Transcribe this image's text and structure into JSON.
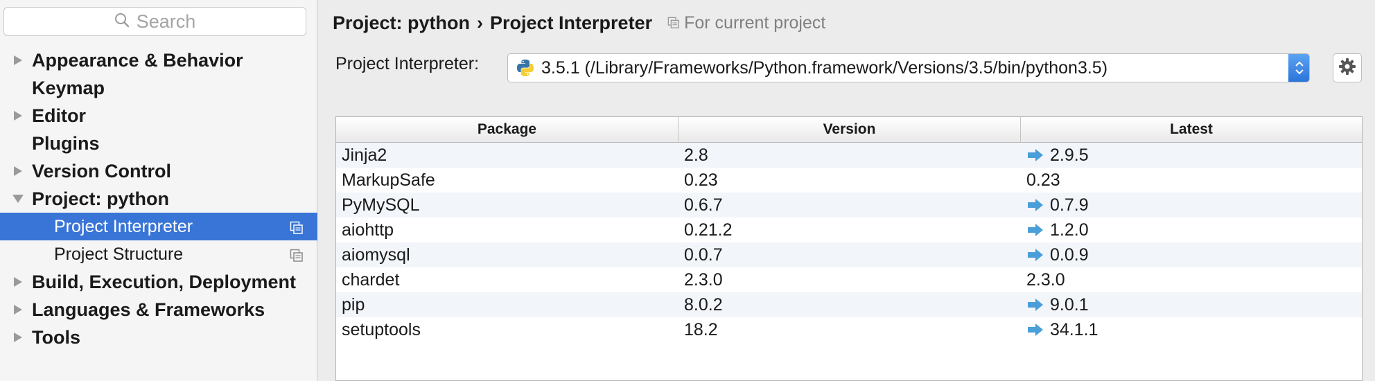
{
  "search": {
    "placeholder": "Search"
  },
  "sidebar": {
    "items": [
      {
        "label": "Appearance & Behavior",
        "expandable": true,
        "expanded": false
      },
      {
        "label": "Keymap",
        "expandable": false
      },
      {
        "label": "Editor",
        "expandable": true,
        "expanded": false
      },
      {
        "label": "Plugins",
        "expandable": false
      },
      {
        "label": "Version Control",
        "expandable": true,
        "expanded": false
      },
      {
        "label": "Project: python",
        "expandable": true,
        "expanded": true
      },
      {
        "label": "Project Interpreter",
        "sub": true,
        "selected": true
      },
      {
        "label": "Project Structure",
        "sub": true
      },
      {
        "label": "Build, Execution, Deployment",
        "expandable": true,
        "expanded": false
      },
      {
        "label": "Languages & Frameworks",
        "expandable": true,
        "expanded": false
      },
      {
        "label": "Tools",
        "expandable": true,
        "expanded": false
      }
    ]
  },
  "breadcrumb": {
    "parent": "Project: python",
    "separator": "›",
    "current": "Project Interpreter",
    "scope": "For current project"
  },
  "interpreter": {
    "label": "Project Interpreter:",
    "value": "3.5.1 (/Library/Frameworks/Python.framework/Versions/3.5/bin/python3.5)"
  },
  "packages": {
    "headers": [
      "Package",
      "Version",
      "Latest"
    ],
    "rows": [
      {
        "package": "Jinja2",
        "version": "2.8",
        "latest": "2.9.5",
        "upgrade": true
      },
      {
        "package": "MarkupSafe",
        "version": "0.23",
        "latest": "0.23",
        "upgrade": false
      },
      {
        "package": "PyMySQL",
        "version": "0.6.7",
        "latest": "0.7.9",
        "upgrade": true
      },
      {
        "package": "aiohttp",
        "version": "0.21.2",
        "latest": "1.2.0",
        "upgrade": true
      },
      {
        "package": "aiomysql",
        "version": "0.0.7",
        "latest": "0.0.9",
        "upgrade": true
      },
      {
        "package": "chardet",
        "version": "2.3.0",
        "latest": "2.3.0",
        "upgrade": false
      },
      {
        "package": "pip",
        "version": "8.0.2",
        "latest": "9.0.1",
        "upgrade": true
      },
      {
        "package": "setuptools",
        "version": "18.2",
        "latest": "34.1.1",
        "upgrade": true
      }
    ]
  },
  "colors": {
    "selection": "#3875d7",
    "upgrade_arrow": "#4a9fd8",
    "sidebar_bg": "#f5f5f5",
    "panel_bg": "#ececec"
  }
}
